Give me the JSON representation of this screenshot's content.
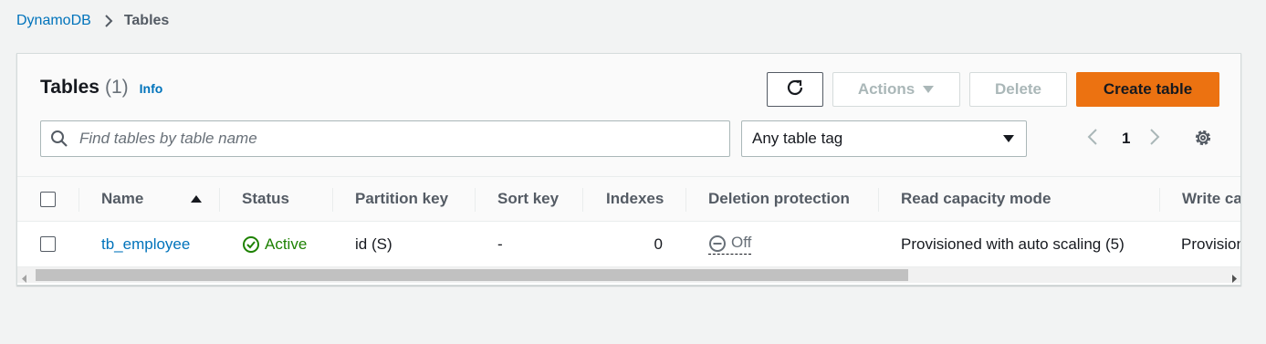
{
  "breadcrumb": {
    "root": "DynamoDB",
    "current": "Tables"
  },
  "header": {
    "title": "Tables",
    "count": "(1)",
    "info": "Info"
  },
  "toolbar": {
    "refresh_icon": "refresh-icon",
    "actions_label": "Actions",
    "delete_label": "Delete",
    "create_label": "Create table"
  },
  "filter": {
    "search_placeholder": "Find tables by table name",
    "search_value": "",
    "tag_select": "Any table tag"
  },
  "pagination": {
    "current_page": "1"
  },
  "table": {
    "columns": [
      "Name",
      "Status",
      "Partition key",
      "Sort key",
      "Indexes",
      "Deletion protection",
      "Read capacity mode",
      "Write capacity mode"
    ],
    "columns_visible": [
      "Name",
      "Status",
      "Partition key",
      "Sort key",
      "Indexes",
      "Deletion protection",
      "Read capacity mode",
      "Write ca"
    ],
    "sort_column": "Name",
    "sort_direction": "ascending",
    "rows": [
      {
        "name": "tb_employee",
        "status": "Active",
        "partition_key": "id (S)",
        "sort_key": "-",
        "indexes": "0",
        "deletion_protection": "Off",
        "read_capacity_mode": "Provisioned with auto scaling (5)",
        "write_capacity_mode_visible": "Provision"
      }
    ]
  },
  "colors": {
    "link": "#0073bb",
    "primary_button": "#ec7211",
    "active_status": "#1d8102",
    "disabled_text": "#aab7b8",
    "page_bg": "#f2f3f3"
  }
}
